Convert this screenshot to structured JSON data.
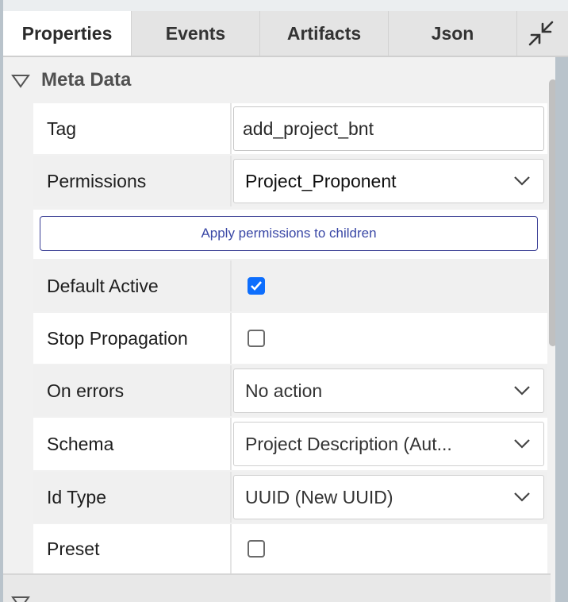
{
  "tabs": [
    {
      "label": "Properties",
      "active": true
    },
    {
      "label": "Events",
      "active": false
    },
    {
      "label": "Artifacts",
      "active": false
    },
    {
      "label": "Json",
      "active": false
    }
  ],
  "colors": {
    "accent": "#0d6efd",
    "button_border": "#3b3f95",
    "button_text": "#3a48a6"
  },
  "section": {
    "title": "Meta Data",
    "rows": {
      "tag": {
        "label": "Tag",
        "value": "add_project_bnt"
      },
      "permissions": {
        "label": "Permissions",
        "value": "Project_Proponent"
      },
      "apply_button": "Apply permissions to children",
      "default_active": {
        "label": "Default Active",
        "checked": true
      },
      "stop_propagation": {
        "label": "Stop Propagation",
        "checked": false
      },
      "on_errors": {
        "label": "On errors",
        "value": "No action"
      },
      "schema": {
        "label": "Schema",
        "value": "Project Description (Aut..."
      },
      "id_type": {
        "label": "Id Type",
        "value": "UUID (New UUID)"
      },
      "preset": {
        "label": "Preset",
        "checked": false
      }
    }
  },
  "icons": {
    "collapse": "collapse-arrows-icon",
    "section_toggle": "triangle-down-icon",
    "dropdown": "chevron-down-icon",
    "check": "checkmark-icon"
  }
}
